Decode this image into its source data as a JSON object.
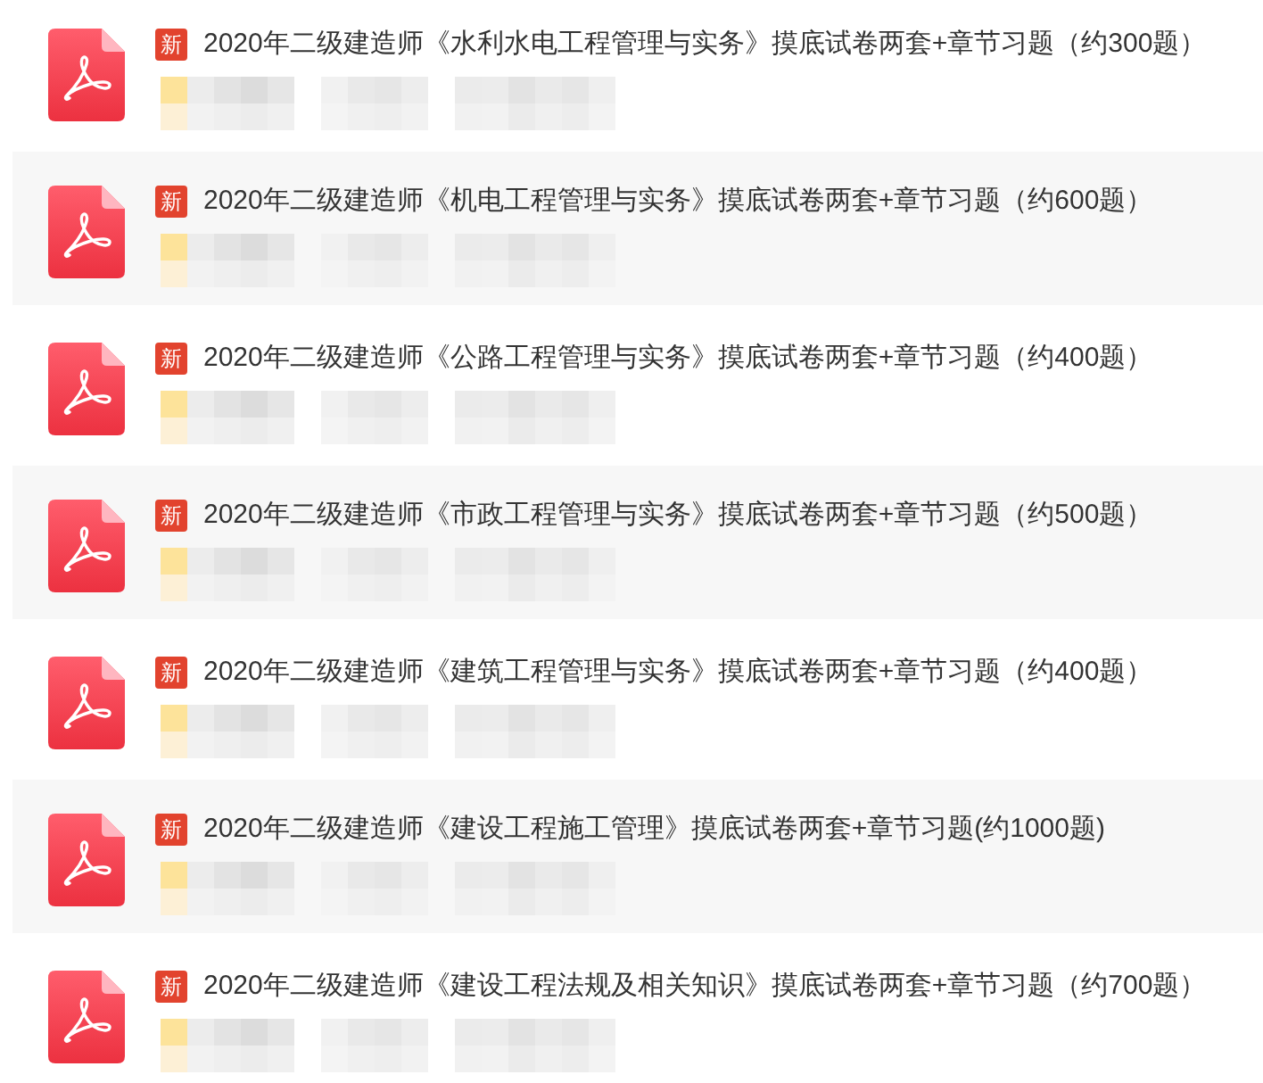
{
  "files": [
    {
      "badge": "新",
      "title": "2020年二级建造师《水利水电工程管理与实务》摸底试卷两套+章节习题（约300题）"
    },
    {
      "badge": "新",
      "title": "2020年二级建造师《机电工程管理与实务》摸底试卷两套+章节习题（约600题）"
    },
    {
      "badge": "新",
      "title": "2020年二级建造师《公路工程管理与实务》摸底试卷两套+章节习题（约400题）"
    },
    {
      "badge": "新",
      "title": "2020年二级建造师《市政工程管理与实务》摸底试卷两套+章节习题（约500题）"
    },
    {
      "badge": "新",
      "title": "2020年二级建造师《建筑工程管理与实务》摸底试卷两套+章节习题（约400题）"
    },
    {
      "badge": "新",
      "title": "2020年二级建造师《建设工程施工管理》摸底试卷两套+章节习题(约1000题)"
    },
    {
      "badge": "新",
      "title": "2020年二级建造师《建设工程法规及相关知识》摸底试卷两套+章节习题（约700题）"
    }
  ]
}
